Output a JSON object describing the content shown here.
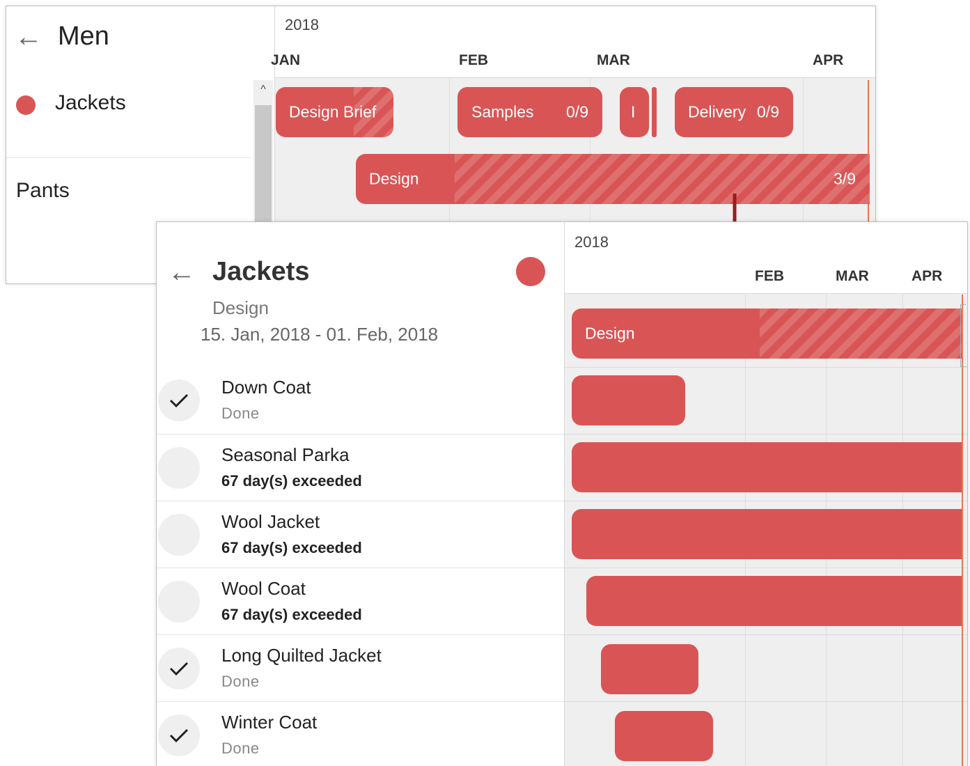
{
  "colors": {
    "accent": "#d95555",
    "today_line": "#e8764c",
    "arrow": "#9b1c1c"
  },
  "back": {
    "header": {
      "back_icon": "←",
      "title": "Men"
    },
    "items": [
      {
        "label": "Jackets",
        "color": "#d95555"
      },
      {
        "label": "Pants"
      }
    ],
    "scroll_up": "^",
    "timeline": {
      "year": "2018",
      "months": [
        "JAN",
        "FEB",
        "MAR",
        "APR"
      ]
    },
    "bars": {
      "design_brief": "Design Brief",
      "samples": {
        "label": "Samples",
        "count": "0/9"
      },
      "small": "I",
      "delivery": {
        "label": "Delivery",
        "count": "0/9"
      },
      "design": {
        "label": "Design",
        "count": "3/9"
      }
    }
  },
  "front": {
    "header": {
      "back_icon": "←",
      "title": "Jackets",
      "subtitle": "Design",
      "dates": "15. Jan, 2018 - 01. Feb, 2018",
      "color": "#d95555"
    },
    "tasks": [
      {
        "name": "Down Coat",
        "status": "Done",
        "done": true
      },
      {
        "name": "Seasonal Parka",
        "status": "67 day(s) exceeded",
        "done": false
      },
      {
        "name": "Wool Jacket",
        "status": "67 day(s) exceeded",
        "done": false
      },
      {
        "name": "Wool Coat",
        "status": "67 day(s) exceeded",
        "done": false
      },
      {
        "name": "Long Quilted Jacket",
        "status": "Done",
        "done": true
      },
      {
        "name": "Winter Coat",
        "status": "Done",
        "done": true
      }
    ],
    "timeline": {
      "year": "2018",
      "months": [
        "FEB",
        "MAR",
        "APR"
      ]
    },
    "design_bar": "Design"
  }
}
